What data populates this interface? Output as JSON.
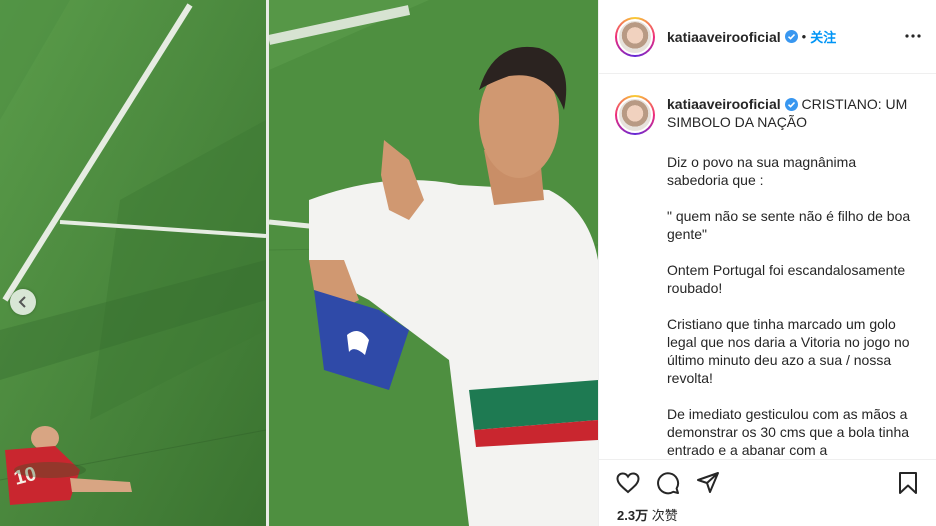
{
  "post": {
    "username": "katiaaveirooficial",
    "follow_label": "关注",
    "separator": "•",
    "caption_title": "CRISTIANO: UM SIMBOLO DA NAÇÃO",
    "paragraphs": [
      "Diz o povo na sua magnânima sabedoria que :",
      "\" quem não se sente não é filho de boa gente\"",
      "Ontem Portugal foi escandalosamente roubado!",
      "Cristiano que tinha marcado um golo legal que nos daria a Vitoria no jogo no último minuto deu azo a sua / nossa revolta!",
      "De imediato gesticulou com as mãos a demonstrar os 30 cms que a bola tinha entrado e a abanar com a"
    ],
    "likes_count": "2.3万",
    "likes_label": "次赞"
  },
  "icons": {
    "prev": "chevron-left-icon",
    "verified": "verified-badge-icon",
    "more": "more-options-icon",
    "like": "heart-icon",
    "comment": "comment-icon",
    "share": "send-icon",
    "save": "bookmark-icon"
  },
  "colors": {
    "accent": "#0095f6",
    "text": "#262626",
    "divider": "#efefef"
  }
}
